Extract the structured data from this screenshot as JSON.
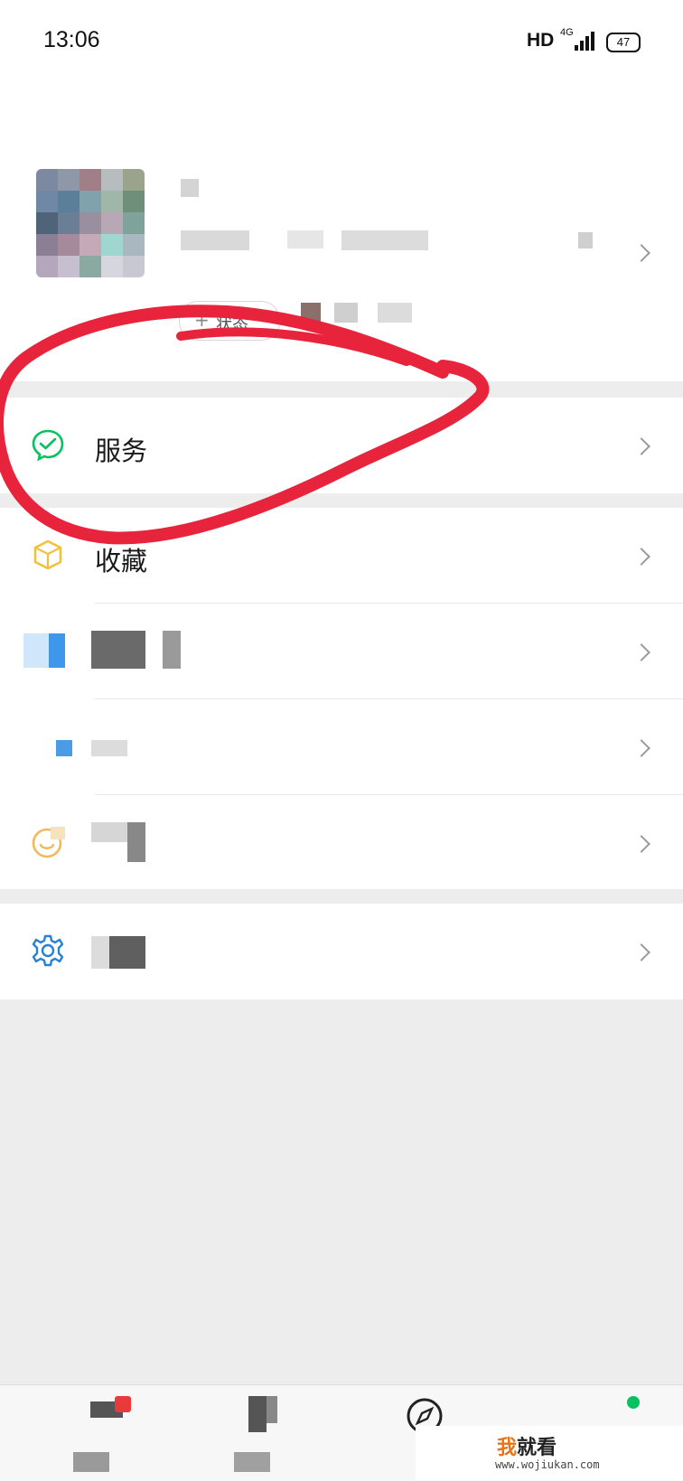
{
  "status_bar": {
    "time": "13:06",
    "hd": "HD",
    "network": "4G",
    "battery": "47"
  },
  "profile": {
    "status_button": "状态"
  },
  "menu": {
    "services": {
      "label": "服务",
      "icon": "wechat-pay-check-icon"
    },
    "favorites": {
      "label": "收藏",
      "icon": "favorites-cube-icon"
    },
    "moments": {
      "label": "",
      "icon": "moments-icon"
    },
    "cards": {
      "label": "",
      "icon": "cards-icon"
    },
    "stickers": {
      "label": "",
      "icon": "sticker-smile-icon"
    },
    "settings": {
      "label": "",
      "icon": "gear-icon"
    }
  },
  "tabs": [
    {
      "label": "",
      "icon": "chats-icon"
    },
    {
      "label": "",
      "icon": "contacts-icon"
    },
    {
      "label": "",
      "icon": "discover-compass-icon"
    },
    {
      "label": "",
      "icon": "me-icon"
    }
  ],
  "watermark": {
    "title_accent": "我",
    "title_rest": "就看",
    "url": "www.wojiukan.com"
  },
  "colors": {
    "accent_green": "#07c160",
    "annotation_red": "#e8243c",
    "settings_blue": "#2782d7",
    "background": "#ededed"
  }
}
